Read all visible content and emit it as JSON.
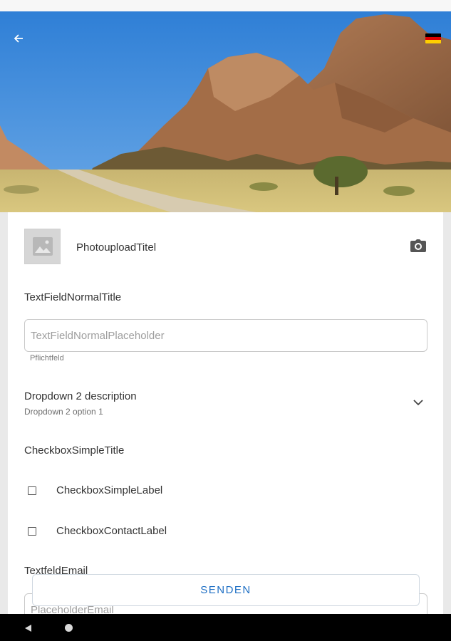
{
  "header": {
    "back_icon": "arrow-left-icon",
    "language_flag": "germany-flag-icon",
    "flag_colors": [
      "#000000",
      "#dd0000",
      "#ffce00"
    ]
  },
  "photo_upload": {
    "title": "PhotouploadTitel",
    "thumbnail_icon": "image-placeholder-icon",
    "camera_icon": "camera-icon"
  },
  "text_field": {
    "title": "TextFieldNormalTitle",
    "placeholder": "TextFieldNormalPlaceholder",
    "helper": "Pflichtfeld"
  },
  "dropdown": {
    "description": "Dropdown 2 description",
    "selected": "Dropdown 2 option 1",
    "chevron_icon": "chevron-down-icon"
  },
  "checkbox": {
    "title": "CheckboxSimpleTitle",
    "simple_label": "CheckboxSimpleLabel",
    "contact_label": "CheckboxContactLabel"
  },
  "email": {
    "title": "TextfeldEmail",
    "placeholder": "PlaceholderEmail"
  },
  "actions": {
    "send_label": "SENDEN"
  },
  "colors": {
    "accent": "#1e6fc4",
    "card_bg": "#ffffff",
    "page_bg": "#e9e9e9"
  }
}
